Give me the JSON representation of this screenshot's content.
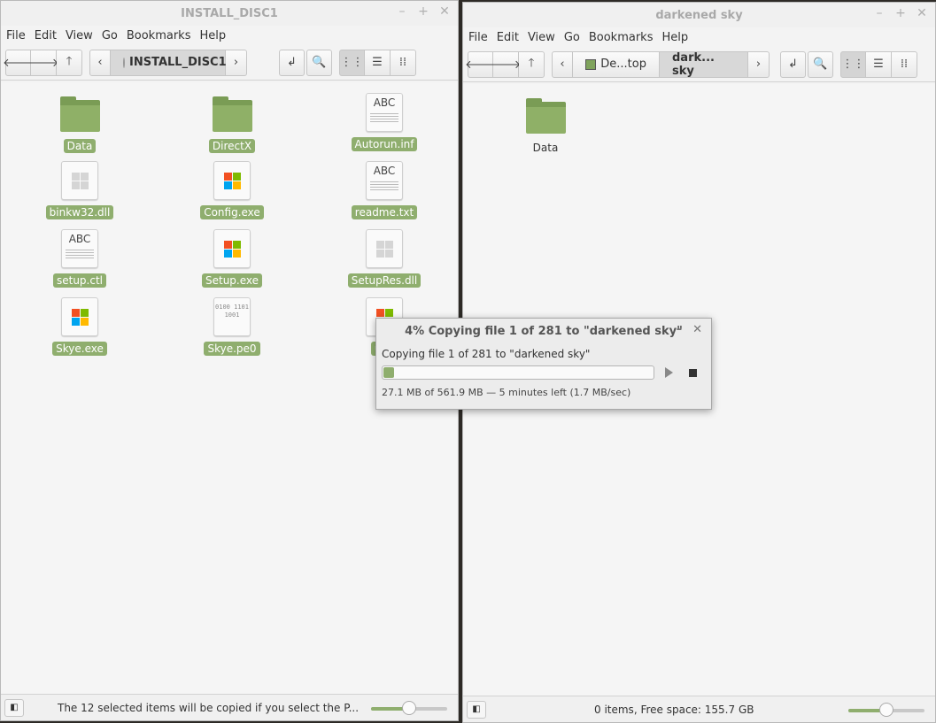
{
  "left": {
    "title": "INSTALL_DISC1",
    "menu": [
      "File",
      "Edit",
      "View",
      "Go",
      "Bookmarks",
      "Help"
    ],
    "path": [
      "INSTALL_DISC1"
    ],
    "files": [
      {
        "name": "Data",
        "icon": "folder-icon"
      },
      {
        "name": "DirectX",
        "icon": "folder-icon"
      },
      {
        "name": "Autorun.inf",
        "icon": "text-file-icon",
        "glyph": "ABC"
      },
      {
        "name": "binkw32.dll",
        "icon": "library-file-icon"
      },
      {
        "name": "Config.exe",
        "icon": "windows-executable-icon"
      },
      {
        "name": "readme.txt",
        "icon": "text-file-icon",
        "glyph": "ABC"
      },
      {
        "name": "setup.ctl",
        "icon": "text-file-icon",
        "glyph": "ABC"
      },
      {
        "name": "Setup.exe",
        "icon": "windows-executable-icon"
      },
      {
        "name": "SetupRes.dll",
        "icon": "library-file-icon"
      },
      {
        "name": "Skye.exe",
        "icon": "windows-executable-icon"
      },
      {
        "name": "Skye.pe0",
        "icon": "binary-file-icon",
        "glyph": "0100 1101 1001"
      },
      {
        "name": "unv",
        "icon": "windows-executable-icon"
      }
    ],
    "status": "The 12 selected items will be copied if you select the P...",
    "zoom": 0.5
  },
  "right": {
    "title": "darkened sky",
    "menu": [
      "File",
      "Edit",
      "View",
      "Go",
      "Bookmarks",
      "Help"
    ],
    "path": [
      "De...top",
      "dark... sky"
    ],
    "files": [
      {
        "name": "Data",
        "icon": "folder-icon"
      }
    ],
    "status": "0 items, Free space: 155.7 GB",
    "zoom": 0.5
  },
  "dialog": {
    "title": "4% Copying file 1 of 281 to \"darkened sky\"",
    "message": "Copying file 1 of 281 to \"darkened sky\"",
    "progress": 0.04,
    "details": "27.1 MB of 561.9 MB — 5 minutes left (1.7 MB/sec)"
  },
  "colors": {
    "accent": "#8fae6e",
    "folder": "#8fb067"
  }
}
